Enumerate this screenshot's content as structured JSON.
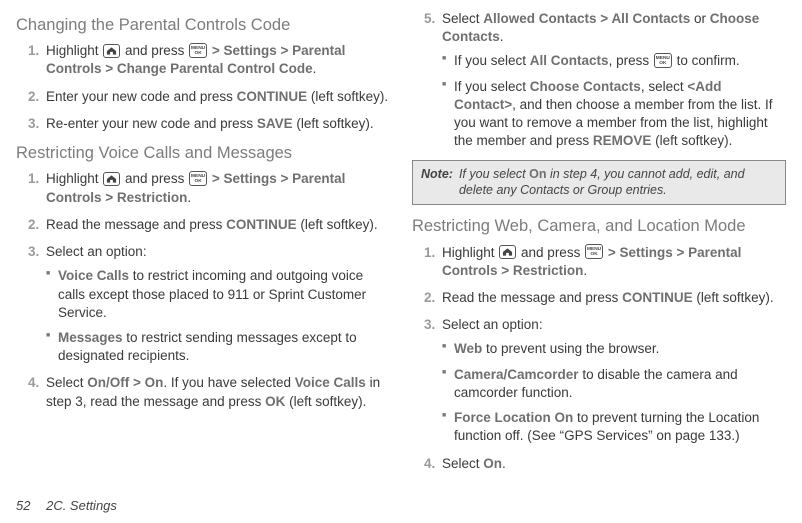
{
  "footer": {
    "page_number": "52",
    "section": "2C. Settings"
  },
  "icon": {
    "menu": "MENU",
    "ok": "OK"
  },
  "left": {
    "heading1": "Changing the Parental Controls Code",
    "s1": {
      "n1": "1.",
      "t1a": "Highlight ",
      "t1b": " and press ",
      "t1c": " > ",
      "t1d": "Settings",
      "t1e": " > ",
      "t1f": "Parental Controls",
      "t1g": " > ",
      "t1h": "Change Parental Control Code",
      "t1i": ".",
      "n2": "2.",
      "t2a": "Enter your new code and press ",
      "t2b": "CONTINUE",
      "t2c": " (left softkey).",
      "n3": "3.",
      "t3a": "Re-enter your new code and press ",
      "t3b": "SAVE",
      "t3c": " (left softkey)."
    },
    "heading2": "Restricting Voice Calls and Messages",
    "s2": {
      "n1": "1.",
      "t1a": "Highlight ",
      "t1b": " and press ",
      "t1c": " > ",
      "t1d": "Settings",
      "t1e": " > ",
      "t1f": "Parental Controls",
      "t1g": " > ",
      "t1h": "Restriction",
      "t1i": ".",
      "n2": "2.",
      "t2a": "Read the message and press ",
      "t2b": "CONTINUE",
      "t2c": " (left softkey).",
      "n3": "3.",
      "t3": "Select an option:",
      "b1a": "Voice Calls",
      "b1b": " to restrict incoming and outgoing voice calls except those placed to 911 or Sprint Customer Service.",
      "b2a": "Messages",
      "b2b": " to restrict sending messages except to designated recipients.",
      "n4": "4.",
      "t4a": "Select ",
      "t4b": "On/Off",
      "t4c": " > ",
      "t4d": "On",
      "t4e": ". If you have selected ",
      "t4f": "Voice Calls",
      "t4g": " in step 3, read the message and press ",
      "t4h": "OK",
      "t4i": " (left softkey)."
    }
  },
  "right": {
    "s5": {
      "n5": "5.",
      "t5a": "Select ",
      "t5b": "Allowed Contacts",
      "t5c": " > ",
      "t5d": "All Contacts",
      "t5e": " or ",
      "t5f": "Choose Contacts",
      "t5g": ".",
      "b1a": "If you select ",
      "b1b": "All Contacts",
      "b1c": ", press ",
      "b1d": " to confirm.",
      "b2a": "If you select ",
      "b2b": "Choose Contacts",
      "b2c": ", select ",
      "b2d": "<Add Contact>",
      "b2e": ", and then choose a member from the list. If you want to remove a member from the list, highlight the member and press ",
      "b2f": "REMOVE",
      "b2g": " (left softkey)."
    },
    "note": {
      "label": "Note:",
      "a": "If you select ",
      "b": "On",
      "c": " in step 4, you cannot add, edit, and delete any Contacts or Group entries."
    },
    "heading3": "Restricting Web, Camera, and Location Mode",
    "s3": {
      "n1": "1.",
      "t1a": "Highlight ",
      "t1b": " and press ",
      "t1c": " > ",
      "t1d": "Settings",
      "t1e": " > ",
      "t1f": "Parental Controls",
      "t1g": " > ",
      "t1h": "Restriction",
      "t1i": ".",
      "n2": "2.",
      "t2a": "Read the message and press ",
      "t2b": "CONTINUE",
      "t2c": " (left softkey).",
      "n3": "3.",
      "t3": "Select an option:",
      "b1a": "Web",
      "b1b": " to prevent using the browser.",
      "b2a": "Camera/Camcorder",
      "b2b": " to disable the camera and camcorder function.",
      "b3a": "Force Location On",
      "b3b": " to prevent turning the Location function off. (See “GPS Services” on page 133.)",
      "n4": "4.",
      "t4a": "Select ",
      "t4b": "On",
      "t4c": "."
    }
  }
}
